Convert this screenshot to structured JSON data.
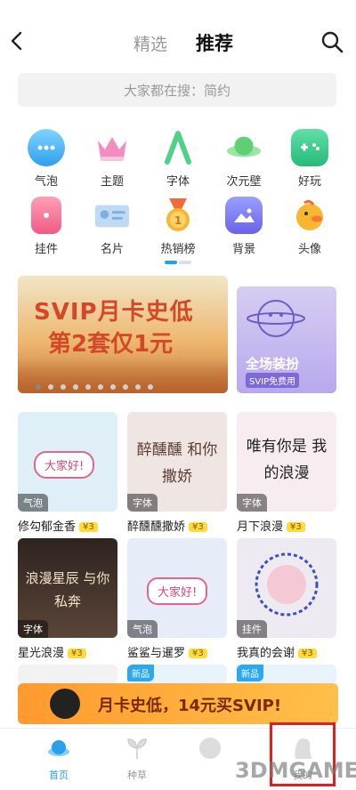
{
  "header": {
    "tab_left": "精选",
    "tab_right": "推荐"
  },
  "search": {
    "placeholder": "大家都在搜：简约"
  },
  "grid": [
    {
      "label": "气泡",
      "icon": "bubble-icon",
      "color": "#3bb0f0"
    },
    {
      "label": "主题",
      "icon": "crown-icon",
      "color": "#f06aa8"
    },
    {
      "label": "字体",
      "icon": "font-a-icon",
      "color": "#59d38a"
    },
    {
      "label": "次元壁",
      "icon": "planet-icon",
      "color": "#6cd07a"
    },
    {
      "label": "好玩",
      "icon": "gamepad-icon",
      "color": "#38c78f"
    },
    {
      "label": "挂件",
      "icon": "tag-icon",
      "color": "#f26b8a"
    },
    {
      "label": "名片",
      "icon": "card-icon",
      "color": "#7eb6e8"
    },
    {
      "label": "热销榜",
      "icon": "medal-icon",
      "color": "#f5a623"
    },
    {
      "label": "背景",
      "icon": "image-icon",
      "color": "#7b79f2"
    },
    {
      "label": "头像",
      "icon": "avatar-duck-icon",
      "color": "#f7b731"
    }
  ],
  "banner_main": {
    "line1": "SVIP月卡史低",
    "line2": "第2套仅1元"
  },
  "banner_side": {
    "line1": "全场装扮",
    "line2": "SVIP免费用"
  },
  "cards": [
    {
      "name": "修勾郁金香",
      "tag": "气泡",
      "price": "¥3",
      "bg": "#dfeff7",
      "caption": "大家好!"
    },
    {
      "name": "醉醺醺撒娇",
      "tag": "字体",
      "price": "¥3",
      "bg": "#efe6e3",
      "caption": "醉醺醺 和你撒娇"
    },
    {
      "name": "月下浪漫",
      "tag": "字体",
      "price": "¥3",
      "bg": "#f7edf0",
      "caption": "唯有你是 我的浪漫"
    },
    {
      "name": "星光浪漫",
      "tag": "字体",
      "price": "¥3",
      "bg": "#3a2d2a",
      "caption": "浪漫星辰 与你私奔"
    },
    {
      "name": "鲨鲨与暹罗",
      "tag": "气泡",
      "price": "¥3",
      "bg": "#e6edf8",
      "caption": "大家好!"
    },
    {
      "name": "我真的会谢",
      "tag": "挂件",
      "price": "¥3",
      "bg": "#eeeaf2",
      "caption": ""
    }
  ],
  "bottom_cards": [
    {
      "tag": ""
    },
    {
      "tag": "新品"
    },
    {
      "tag": "新品"
    }
  ],
  "promo": {
    "text": "月卡史低，14元买SVIP!"
  },
  "tabbar": [
    {
      "label": "首页",
      "active": true
    },
    {
      "label": "种草",
      "active": false
    },
    {
      "label": "",
      "active": false
    },
    {
      "label": "我的",
      "active": false
    }
  ],
  "watermark": "3DMGAME"
}
